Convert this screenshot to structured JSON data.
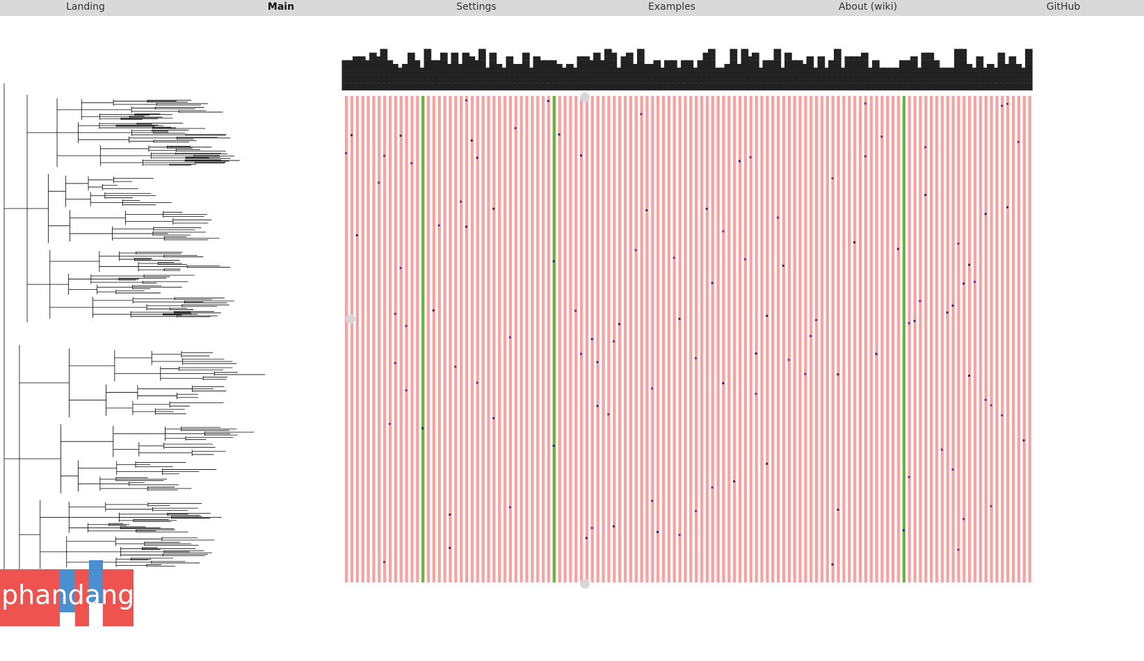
{
  "nav": {
    "landing": "Landing",
    "main": "Main",
    "settings": "Settings",
    "examples": "Examples",
    "about": "About (wiki)",
    "github": "GitHub"
  },
  "logo": {
    "text": "phandango"
  },
  "colors": {
    "nav_bg": "#d9d9d9",
    "grid_absent": "#f5a3a3",
    "grid_present": "#6ab33f",
    "grid_accent_orange": "#f4a23a",
    "grid_accent_purple": "#7a2a8a",
    "grid_accent_navy": "#2a2a6a",
    "logo_red": "#ef5350",
    "logo_blue": "#4a8fd0"
  },
  "grid": {
    "columns": 126,
    "green_columns": [
      14,
      38,
      102
    ]
  }
}
